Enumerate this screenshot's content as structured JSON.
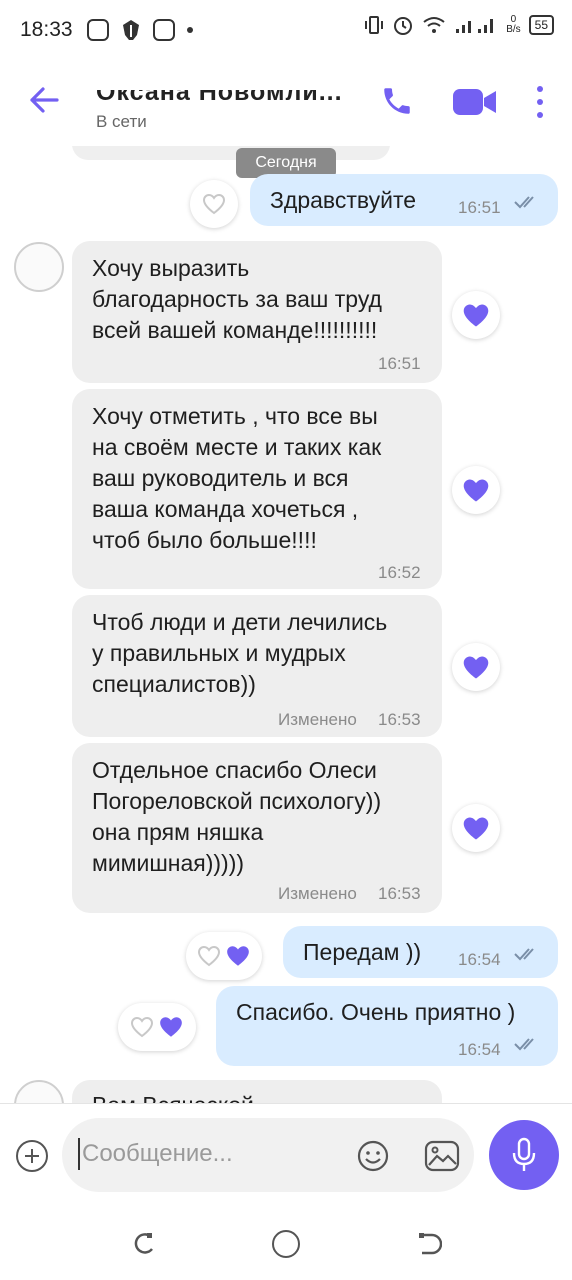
{
  "status_bar": {
    "time": "18:33",
    "net_speed_value": "0",
    "net_speed_unit": "B/s",
    "battery": "55"
  },
  "header": {
    "contact_name": "Оксана Новомли...",
    "contact_status": "В сети",
    "back_icon": "arrow-left-icon",
    "call_icon": "phone-icon",
    "video_icon": "video-camera-icon",
    "more_icon": "more-vertical-icon",
    "accent_color": "#7360f2"
  },
  "chat": {
    "date_separator": "Сегодня",
    "messages": [
      {
        "direction": "out",
        "text": "Здравствуйте",
        "time": "16:51",
        "edited_label": "",
        "read": true,
        "reaction": "none"
      },
      {
        "direction": "in",
        "text": "Хочу выразить\nблагодарность за ваш труд\nвсей вашей команде!!!!!!!!!!",
        "time": "16:51",
        "edited_label": "",
        "reaction": "heart"
      },
      {
        "direction": "in",
        "text": "Хочу отметить , что все вы\nна своём месте и таких как\nваш руководитель и вся\nваша команда хочеться ,\nчтоб было больше!!!!",
        "time": "16:52",
        "edited_label": "",
        "reaction": "heart"
      },
      {
        "direction": "in",
        "text": "Чтоб люди и дети лечились\nу правильных и мудрых\nспециалистов))",
        "time": "16:53",
        "edited_label": "Изменено",
        "reaction": "heart"
      },
      {
        "direction": "in",
        "text": "Отдельное спасибо Олеси\nПогореловской психологу))\nона прям няшка\nмимишная)))))",
        "time": "16:53",
        "edited_label": "Изменено",
        "reaction": "heart"
      },
      {
        "direction": "out",
        "text": "Передам ))",
        "time": "16:54",
        "edited_label": "",
        "read": true,
        "reaction": "heart"
      },
      {
        "direction": "out",
        "text": "Спасибо. Очень приятно )",
        "time": "16:54",
        "edited_label": "",
        "read": true,
        "reaction": "heart"
      },
      {
        "direction": "in",
        "text": "Вам Всяческой...",
        "time": "",
        "edited_label": "",
        "reaction": "none"
      }
    ],
    "reaction_color": "#7360f2"
  },
  "composer": {
    "placeholder": "Сообщение...",
    "plus_icon": "plus-circle-icon",
    "emoji_icon": "smiley-icon",
    "gallery_icon": "image-icon",
    "mic_icon": "microphone-icon"
  },
  "nav_bar": {
    "recent_icon": "recent-apps-icon",
    "home_icon": "home-circle-icon",
    "back_icon": "nav-back-icon"
  }
}
